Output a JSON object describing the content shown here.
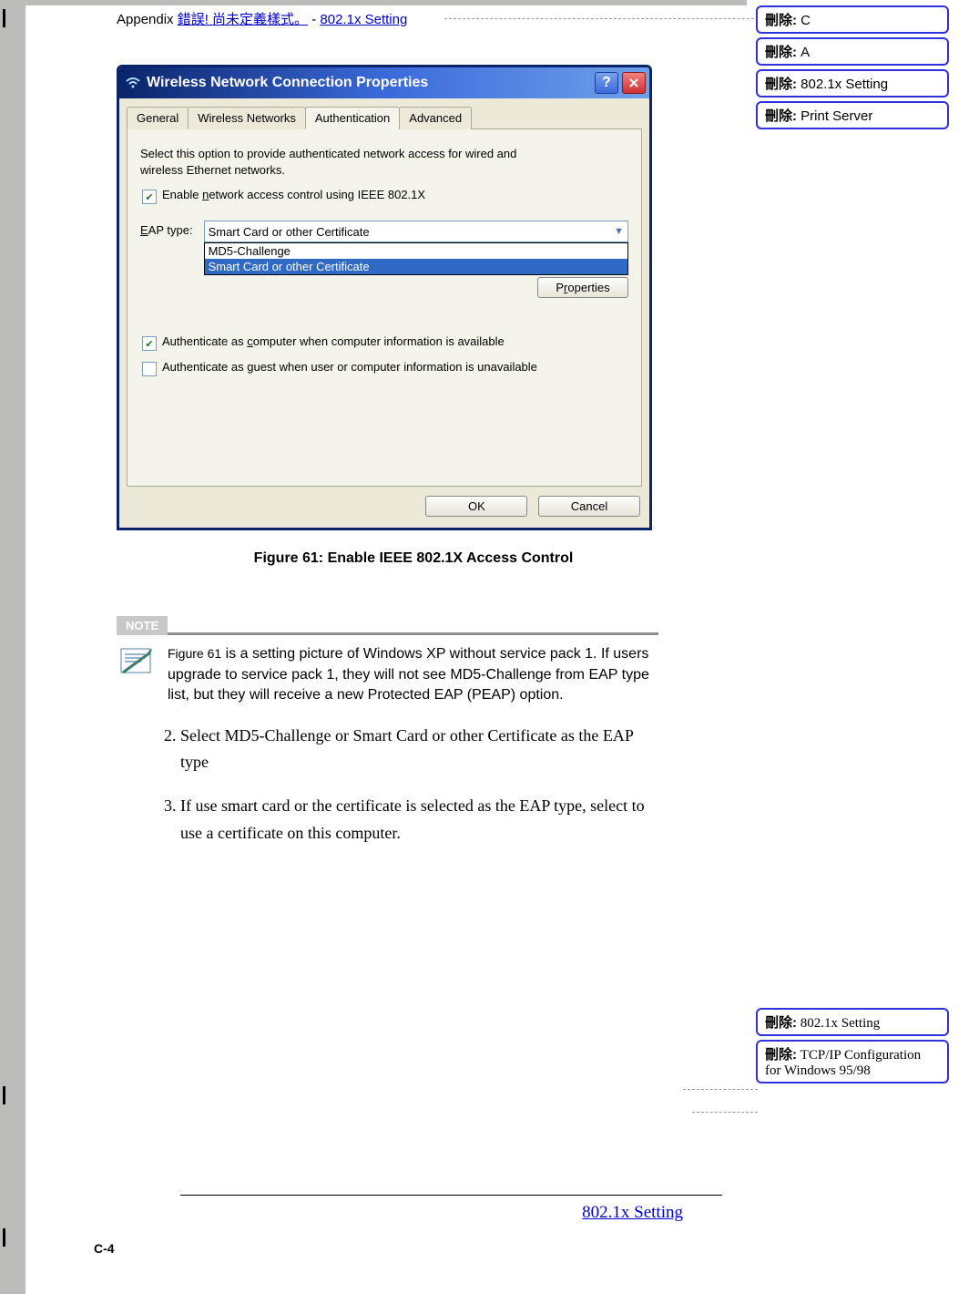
{
  "header": {
    "prefix": "Appendix ",
    "err": "錯誤! 尚未定義樣式。",
    "sep": " - ",
    "link": "802.1x Setting"
  },
  "callouts_top": [
    {
      "label": "刪除:",
      "value": " C"
    },
    {
      "label": "刪除:",
      "value": " A"
    },
    {
      "label": "刪除:",
      "value": " 802.1x Setting"
    },
    {
      "label": "刪除:",
      "value": " Print Server"
    }
  ],
  "callouts_bottom": [
    {
      "label": "刪除:",
      "value": " 802.1x Setting"
    },
    {
      "label": "刪除:",
      "value": " TCP/IP Configuration for Windows 95/98"
    }
  ],
  "dialog": {
    "title": "Wireless Network Connection Properties",
    "tabs": [
      "General",
      "Wireless Networks",
      "Authentication",
      "Advanced"
    ],
    "desc": "Select this option to provide authenticated network access for wired and wireless Ethernet networks.",
    "chk_enable_pre": "Enable ",
    "chk_enable_uchar": "n",
    "chk_enable_post": "etwork access control using IEEE 802.1X",
    "eap_pre": "E",
    "eap_post": "AP type:",
    "eap_selected": "Smart Card or other Certificate",
    "eap_opts": [
      "MD5-Challenge",
      "Smart Card or other Certificate"
    ],
    "props_btn": "Properties",
    "chk_comp_pre": "Authenticate as ",
    "chk_comp_uchar": "c",
    "chk_comp_post": "omputer when computer information is available",
    "chk_guest_pre": "Authenticate as ",
    "chk_guest_uchar": "g",
    "chk_guest_post": "uest when user or computer information is unavailable",
    "ok": "OK",
    "cancel": "Cancel"
  },
  "figure_caption": "Figure 61: Enable IEEE 802.1X Access Control",
  "note": {
    "badge": "NOTE",
    "text_a": "Figure 61",
    "text_b": " is a setting picture of Windows XP without service pack 1. If users upgrade to service pack 1, they will not see MD5-Challenge from EAP type list, but they will receive a new Protected EAP (PEAP) option."
  },
  "steps": [
    "Select MD5-Challenge or Smart Card or other Certificate as the EAP type",
    "If use smart card or the certificate is selected as the EAP type, select to use a certificate on this computer."
  ],
  "footer": {
    "link": "802.1x Setting",
    "page": "C-4"
  }
}
